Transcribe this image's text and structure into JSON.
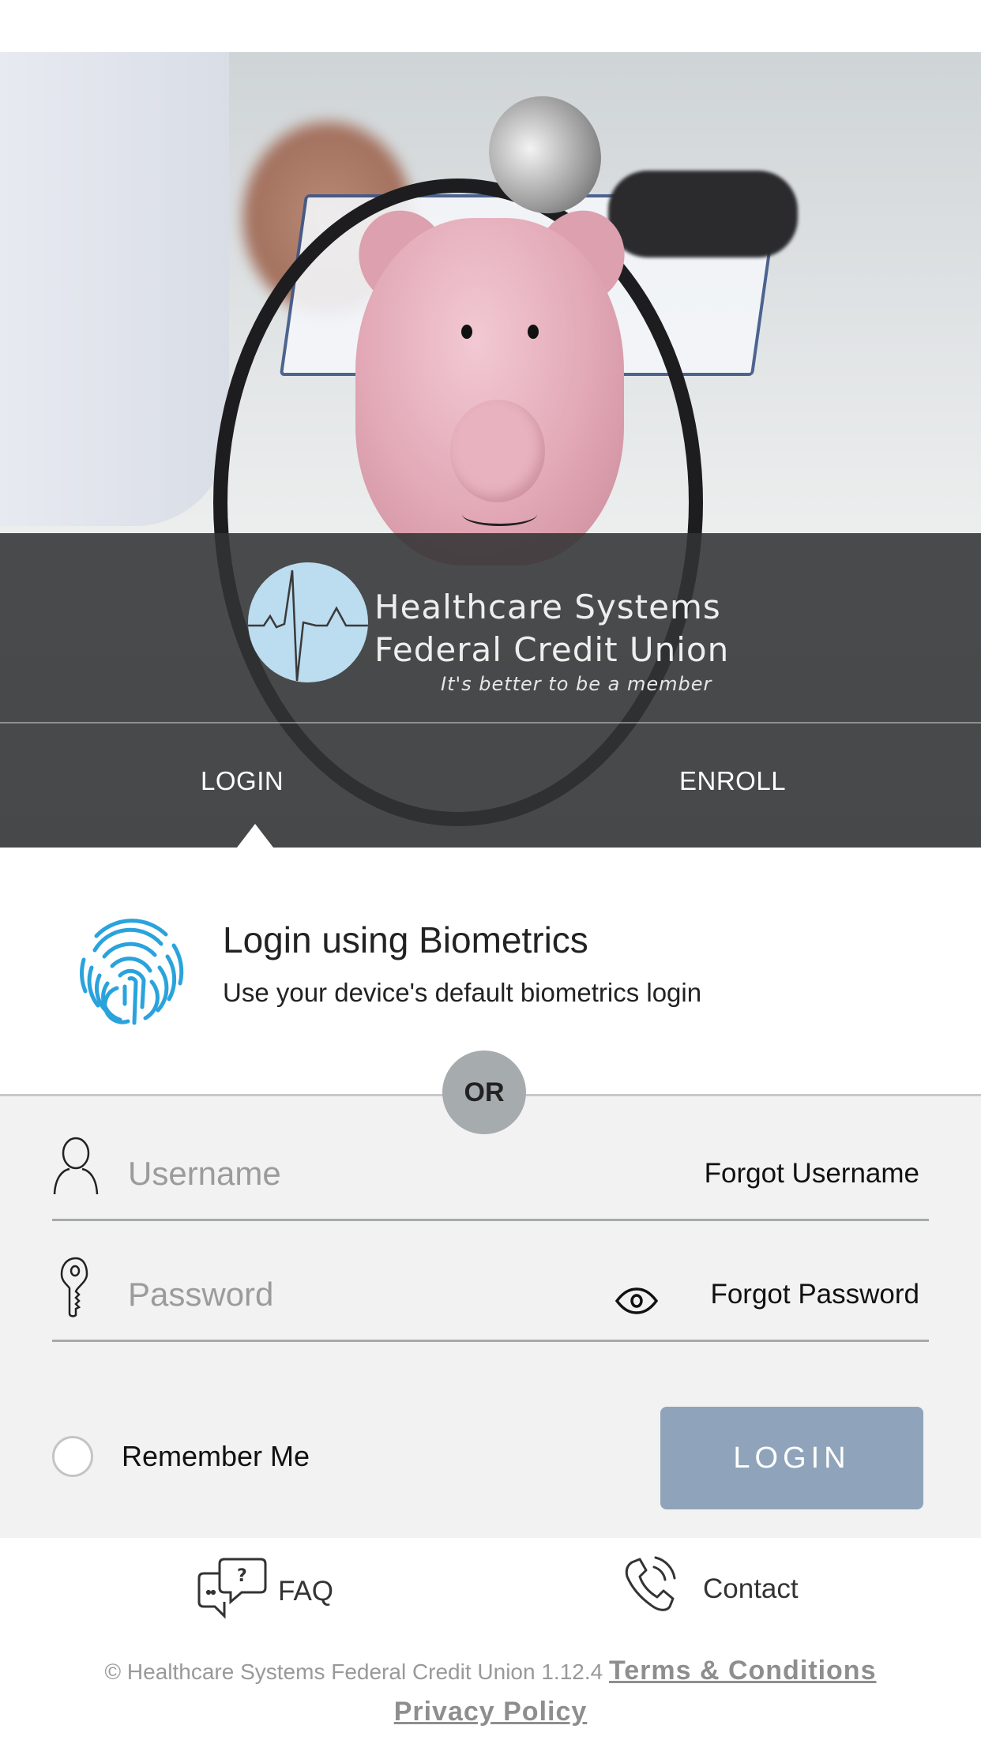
{
  "brand": {
    "line1": "Healthcare Systems",
    "line2": "Federal Credit Union",
    "tagline": "It's better to be a member",
    "logo_circle_color": "#bcdcef"
  },
  "tabs": [
    {
      "label": "LOGIN",
      "active": true
    },
    {
      "label": "ENROLL",
      "active": false
    }
  ],
  "biometrics": {
    "icon": "fingerprint-icon",
    "title": "Login using Biometrics",
    "subtitle": "Use your device's default biometrics login",
    "accent": "#2aa3dc"
  },
  "divider_label": "OR",
  "form": {
    "username": {
      "icon": "user-icon",
      "placeholder": "Username",
      "value": "",
      "forgot": "Forgot Username"
    },
    "password": {
      "icon": "key-icon",
      "placeholder": "Password",
      "value": "",
      "toggle_icon": "eye-icon",
      "forgot": "Forgot Password"
    },
    "remember_label": "Remember Me",
    "remember_checked": false,
    "login_label": "LOGIN",
    "login_color": "#8fa4ba"
  },
  "footer": {
    "faq": {
      "icon": "faq-chat-icon",
      "label": "FAQ"
    },
    "contact": {
      "icon": "phone-icon",
      "label": "Contact"
    },
    "copyright": "© Healthcare Systems Federal Credit Union 1.12.4",
    "terms": "Terms & Conditions",
    "privacy": "Privacy Policy"
  }
}
